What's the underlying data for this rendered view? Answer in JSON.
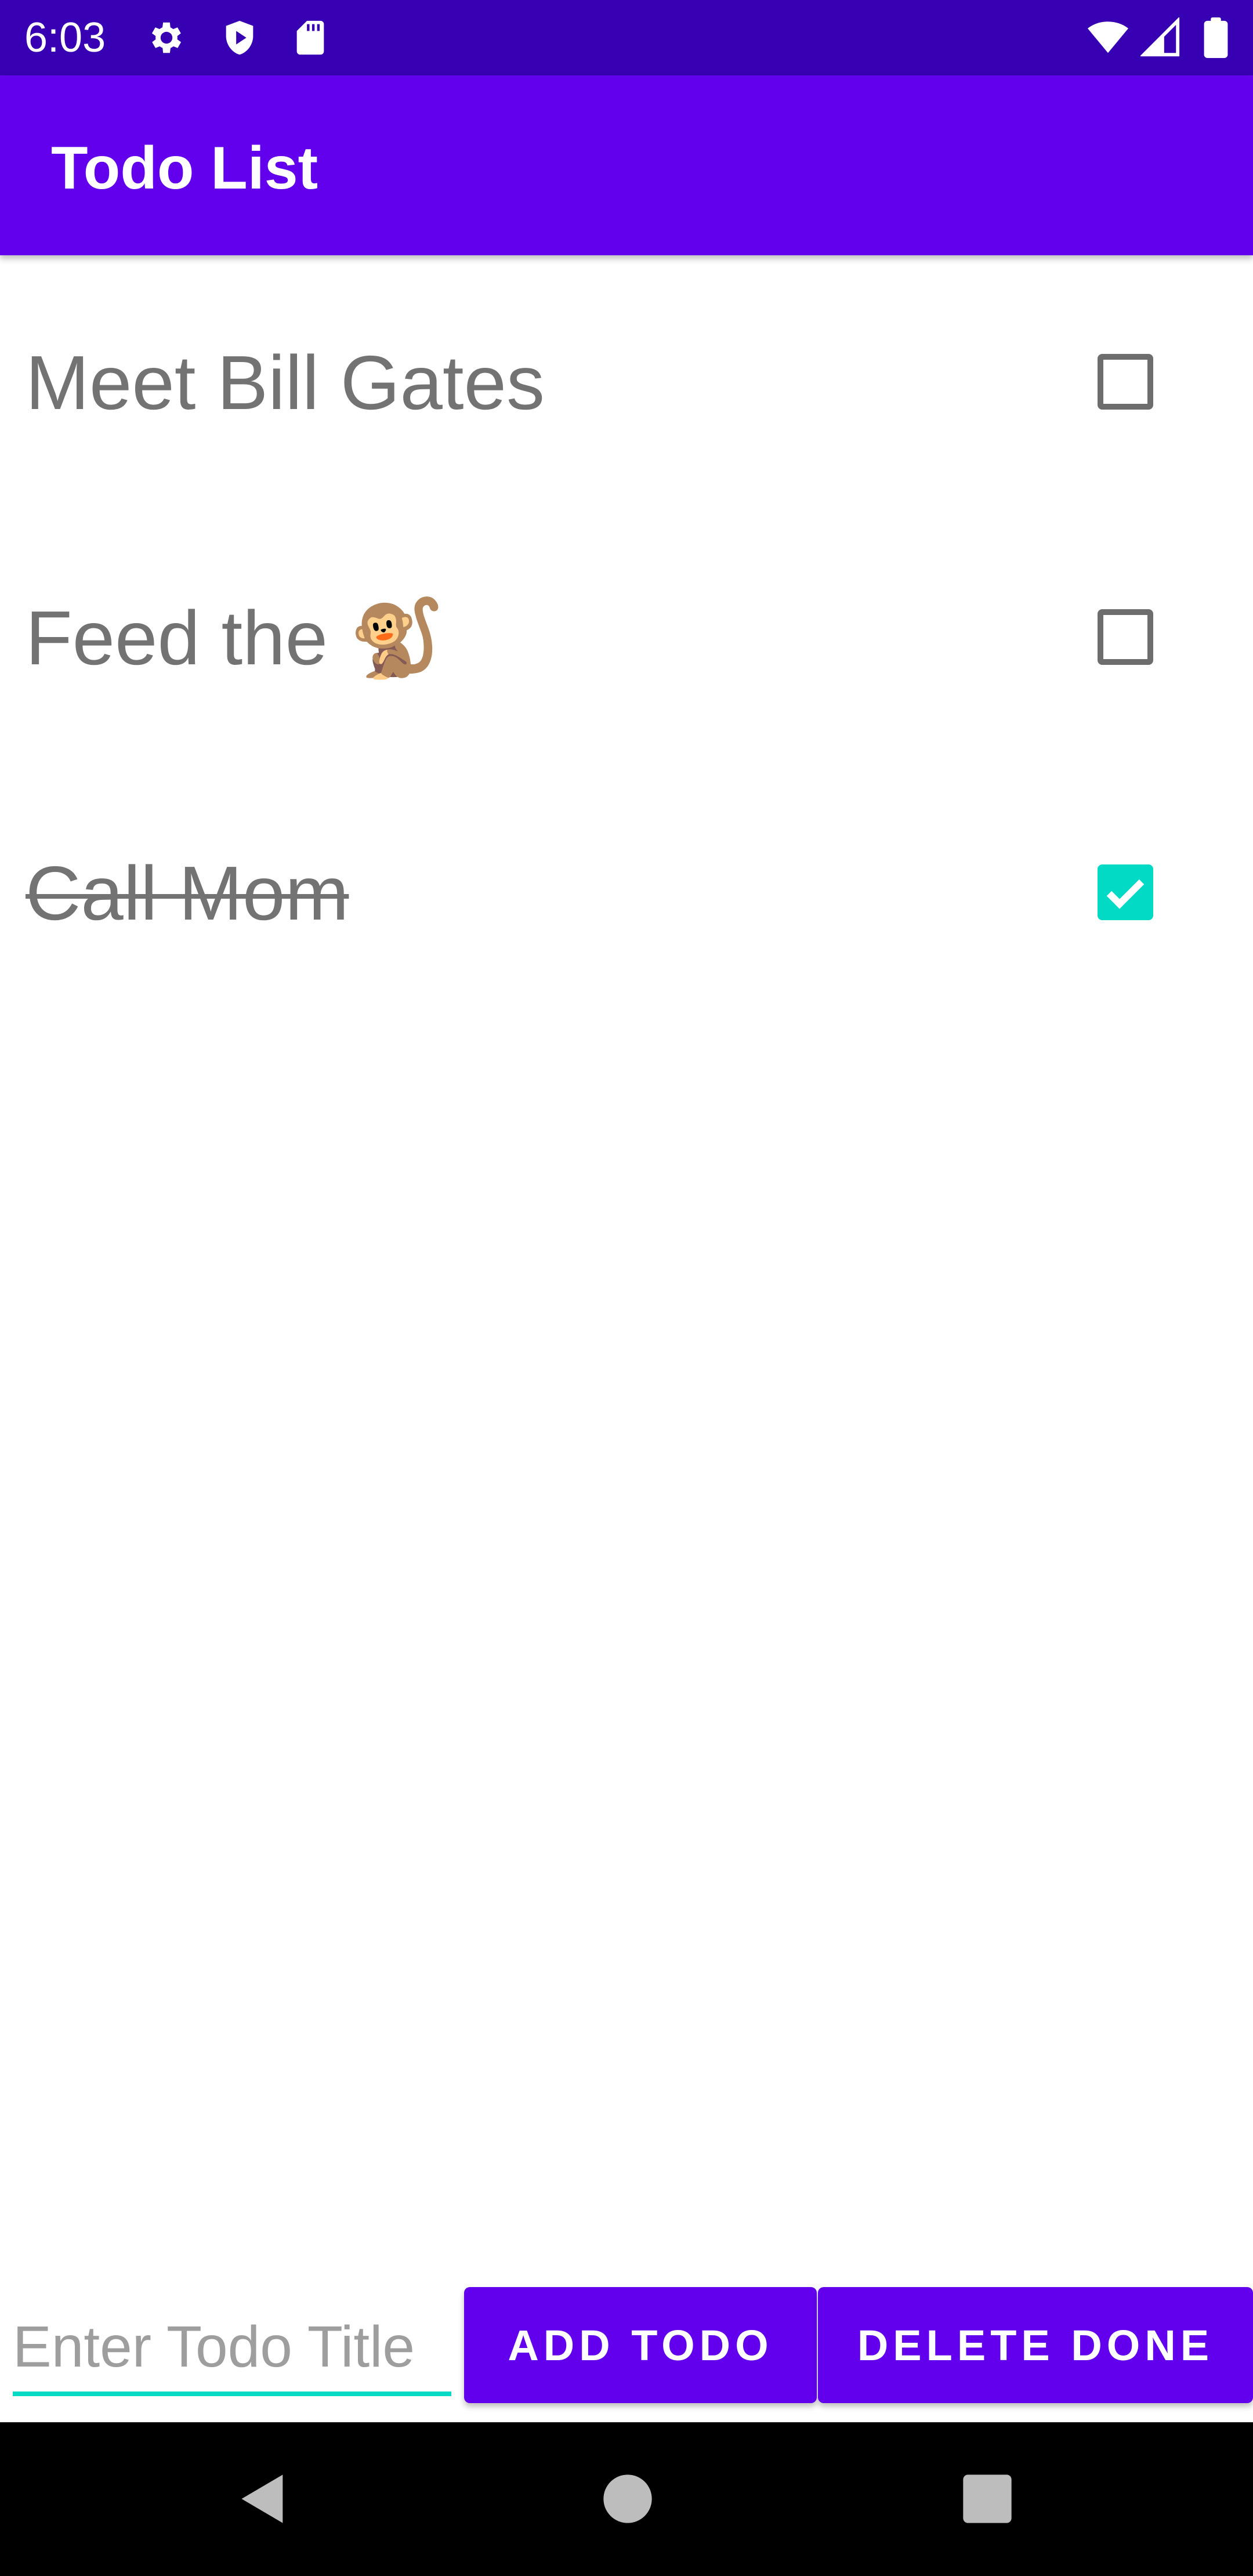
{
  "status_bar": {
    "time": "6:03",
    "icons": [
      "gear-icon",
      "shield-play-icon",
      "sd-card-icon",
      "wifi-icon",
      "signal-icon",
      "battery-icon"
    ],
    "background_color": "#3700b3"
  },
  "app_bar": {
    "title": "Todo List",
    "background_color": "#6200ee"
  },
  "todos": [
    {
      "title": "Meet Bill Gates",
      "done": false
    },
    {
      "title": "Feed the 🐒",
      "done": false
    },
    {
      "title": "Call Mom",
      "done": true
    }
  ],
  "input": {
    "placeholder": "Enter Todo Title",
    "value": ""
  },
  "buttons": {
    "add_label": "ADD TODO",
    "delete_label": "DELETE DONE"
  },
  "nav_bar": {
    "icons": [
      "back-icon",
      "home-icon",
      "recents-icon"
    ]
  },
  "colors": {
    "primary": "#6200ee",
    "primary_dark": "#3700b3",
    "accent": "#03dac5",
    "text_muted": "#737373"
  }
}
